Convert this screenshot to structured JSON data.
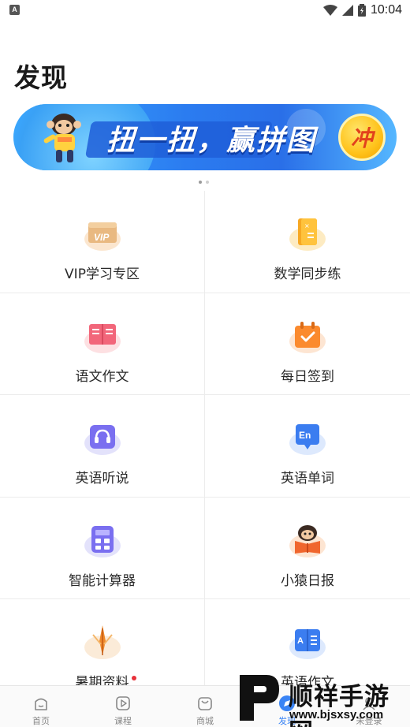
{
  "status_bar": {
    "time": "10:04",
    "app_icon_letter": "A"
  },
  "page_title": "发现",
  "banner": {
    "text": "扭一扭，赢拼图",
    "button": "冲",
    "page_count": 2,
    "active_page": 1
  },
  "grid": {
    "items": [
      {
        "label": "VIP学习专区",
        "icon": "vip-card-icon"
      },
      {
        "label": "数学同步练",
        "icon": "math-book-icon"
      },
      {
        "label": "语文作文",
        "icon": "chinese-book-icon"
      },
      {
        "label": "每日签到",
        "icon": "calendar-check-icon"
      },
      {
        "label": "英语听说",
        "icon": "headset-icon"
      },
      {
        "label": "英语单词",
        "icon": "en-bubble-icon"
      },
      {
        "label": "智能计算器",
        "icon": "calculator-icon"
      },
      {
        "label": "小猿日报",
        "icon": "monkey-reading-icon"
      },
      {
        "label": "暑期资料",
        "icon": "feather-icon",
        "badge": true
      },
      {
        "label": "英语作文",
        "icon": "english-book-icon"
      }
    ]
  },
  "bottom_nav": {
    "items": [
      {
        "label": "首页",
        "icon": "home-icon"
      },
      {
        "label": "课程",
        "icon": "play-icon"
      },
      {
        "label": "商城",
        "icon": "shop-bag-icon"
      },
      {
        "label": "发现",
        "icon": "discover-icon",
        "active": true
      },
      {
        "label": "未登录",
        "icon": "user-icon"
      }
    ]
  },
  "watermark": {
    "text": "顺祥手游网",
    "url": "www.bjsxsy.com"
  },
  "colors": {
    "accent": "#3a84f5",
    "banner_blue": "#2b7cf0",
    "badge_red": "#e8313a"
  }
}
